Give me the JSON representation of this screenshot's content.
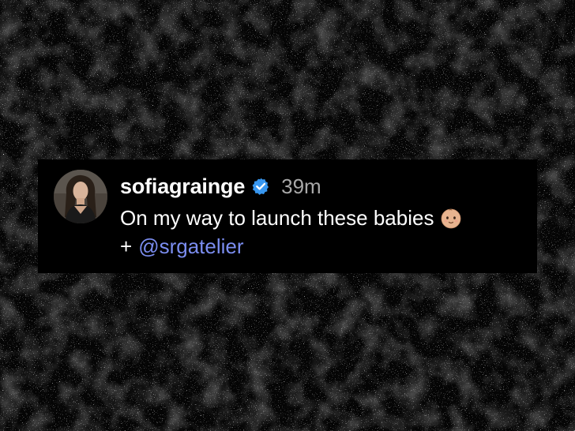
{
  "post": {
    "username": "sofiagrainge",
    "verified": true,
    "timestamp": "39m",
    "caption_line1": "On my way to launch these babies",
    "caption_emoji": "baby-face-emoji",
    "caption_prefix": "+",
    "mention": "@srgatelier"
  },
  "colors": {
    "background": "#050505",
    "card": "#000000",
    "username": "#ffffff",
    "timestamp": "#a8a8a8",
    "mention": "#7b8df0",
    "verified_badge": "#3897f0"
  },
  "icons": {
    "verified": "verified-badge-icon",
    "avatar": "profile-avatar"
  }
}
